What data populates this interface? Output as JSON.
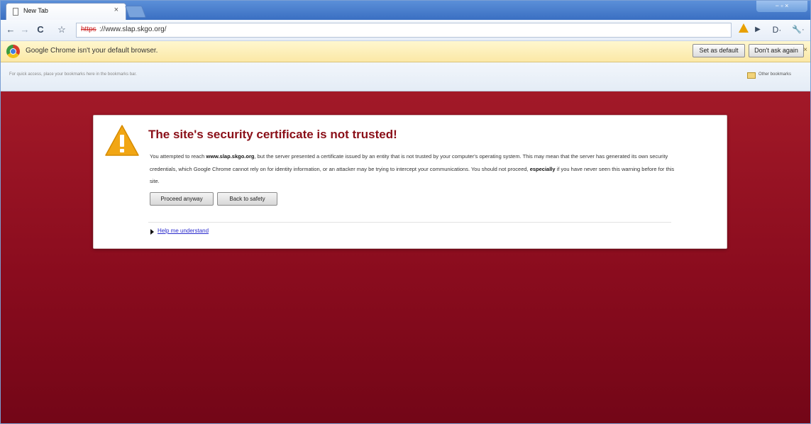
{
  "tab": {
    "title": "New Tab",
    "close": "×"
  },
  "window": {
    "controls": "− ▫ ×"
  },
  "toolbar": {
    "back": "←",
    "forward": "→",
    "reload": "C",
    "star": "☆",
    "url_scheme": "https",
    "url_rest": "://www.slap.skgo.org/",
    "page_menu": "D·",
    "wrench_menu": "🔧·",
    "play": "▶"
  },
  "infobar": {
    "message": "Google Chrome isn't your default browser.",
    "set_default": "Set as default",
    "dont_ask": "Don't ask again",
    "close": "×"
  },
  "bookmarks": {
    "hint": "For quick access, place your bookmarks here in the bookmarks bar.",
    "other": "Other bookmarks"
  },
  "interstitial": {
    "title": "The site's security certificate is not trusted!",
    "para_1_before": "You attempted to reach ",
    "para_1_host": "www.slap.skgo.org",
    "para_1_after": ", but the server presented a certificate issued by an entity that is not trusted by your computer's operating system. This may mean that the server has generated its own security credentials, which Google Chrome cannot rely on for identity information, or an attacker may be trying to intercept your communications. You should not proceed, ",
    "para_1_emph": "especially",
    "para_1_end": " if you have never seen this warning before for this site.",
    "proceed": "Proceed anyway",
    "back_to_safety": "Back to safety",
    "help": "Help me understand"
  },
  "colors": {
    "page_background": "#8a0c1e",
    "heading": "#8a0f18",
    "warning": "#f1a614",
    "link": "#2a2acc"
  }
}
